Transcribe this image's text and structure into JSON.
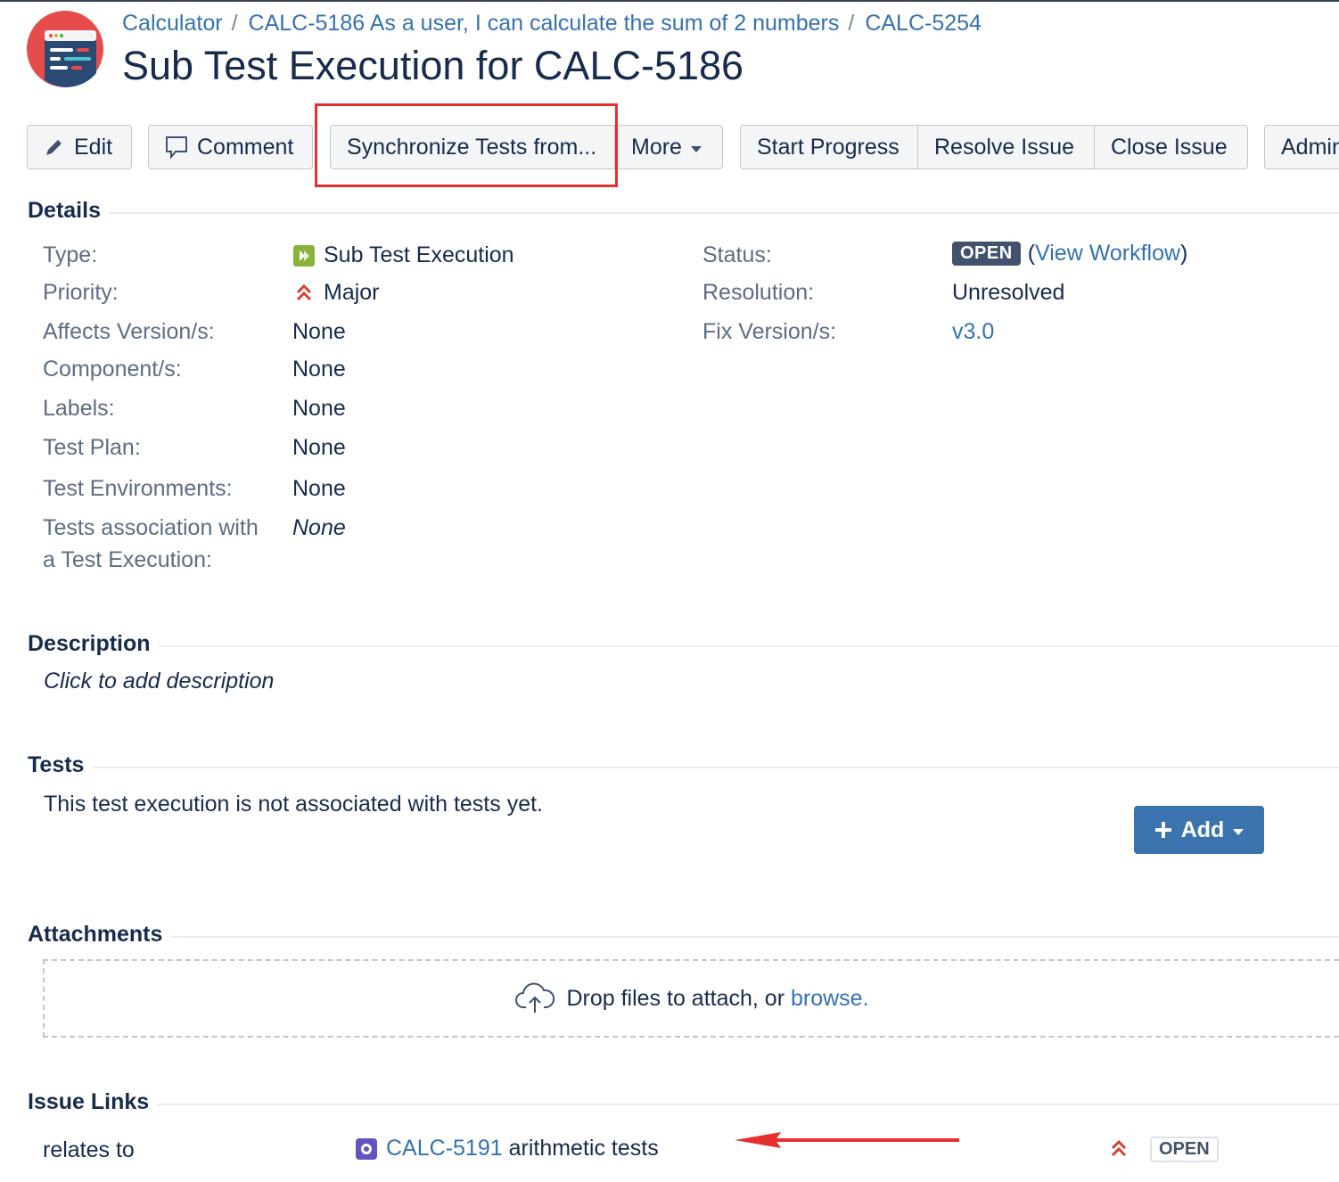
{
  "breadcrumb": {
    "project": "Calculator",
    "parent": "CALC-5186 As a user, I can calculate the sum of 2 numbers",
    "issue_key": "CALC-5254",
    "separator": "/"
  },
  "page_title": "Sub Test Execution for CALC-5186",
  "toolbar": {
    "edit": "Edit",
    "comment": "Comment",
    "synchronize": "Synchronize Tests from...",
    "more": "More",
    "start_progress": "Start Progress",
    "resolve_issue": "Resolve Issue",
    "close_issue": "Close Issue",
    "admin": "Admin"
  },
  "details": {
    "heading": "Details",
    "type_label": "Type:",
    "type_value": "Sub Test Execution",
    "priority_label": "Priority:",
    "priority_value": "Major",
    "affects_label": "Affects Version/s:",
    "affects_value": "None",
    "components_label": "Component/s:",
    "components_value": "None",
    "labels_label": "Labels:",
    "labels_value": "None",
    "test_plan_label": "Test Plan:",
    "test_plan_value": "None",
    "test_env_label": "Test Environments:",
    "test_env_value": "None",
    "tests_assoc_label_1": "Tests association with",
    "tests_assoc_label_2": "a Test Execution:",
    "tests_assoc_value": "None",
    "status_label": "Status:",
    "status_value": "OPEN",
    "view_workflow_open": "(",
    "view_workflow": "View Workflow",
    "view_workflow_close": ")",
    "resolution_label": "Resolution:",
    "resolution_value": "Unresolved",
    "fix_label": "Fix Version/s:",
    "fix_value": "v3.0"
  },
  "description": {
    "heading": "Description",
    "placeholder": "Click to add description"
  },
  "tests": {
    "heading": "Tests",
    "empty_text": "This test execution is not associated with tests yet.",
    "add_label": "Add"
  },
  "attachments": {
    "heading": "Attachments",
    "drop_text": "Drop files to attach, or ",
    "browse": "browse."
  },
  "issue_links": {
    "heading": "Issue Links",
    "relation": "relates to",
    "key": "CALC-5191",
    "summary": "arithmetic tests",
    "status": "OPEN"
  },
  "colors": {
    "link": "#3572b0",
    "highlight": "#e5302f",
    "add_button": "#3b73af",
    "lozenge": "#42526e"
  }
}
